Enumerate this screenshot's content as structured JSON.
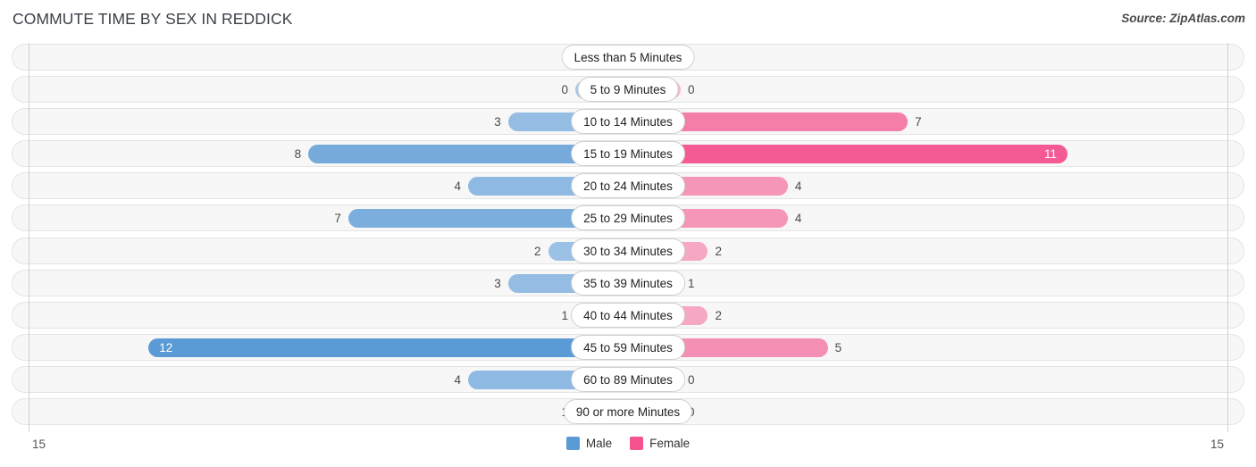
{
  "header": {
    "title": "COMMUTE TIME BY SEX IN REDDICK",
    "source": "Source: ZipAtlas.com"
  },
  "legend": {
    "male_label": "Male",
    "female_label": "Female",
    "male_color": "#5b9bd5",
    "female_color": "#f4538f"
  },
  "axis": {
    "left_end": "15",
    "right_end": "15"
  },
  "chart_data": {
    "type": "bar",
    "subtype": "diverging-bidirectional",
    "title": "COMMUTE TIME BY SEX IN REDDICK",
    "xlabel": "",
    "ylabel": "",
    "xlim": [
      15,
      15
    ],
    "grid": false,
    "legend_position": "bottom-center",
    "categories": [
      "Less than 5 Minutes",
      "5 to 9 Minutes",
      "10 to 14 Minutes",
      "15 to 19 Minutes",
      "20 to 24 Minutes",
      "25 to 29 Minutes",
      "30 to 34 Minutes",
      "35 to 39 Minutes",
      "40 to 44 Minutes",
      "45 to 59 Minutes",
      "60 to 89 Minutes",
      "90 or more Minutes"
    ],
    "series": [
      {
        "name": "Male",
        "direction": "left",
        "color": "#5b9bd5",
        "values": [
          0,
          0,
          3,
          8,
          4,
          7,
          2,
          3,
          1,
          12,
          4,
          1
        ]
      },
      {
        "name": "Female",
        "direction": "right",
        "color": "#f4538f",
        "values": [
          0,
          0,
          7,
          11,
          4,
          4,
          2,
          1,
          2,
          5,
          0,
          0
        ]
      }
    ]
  },
  "rows": [
    {
      "label": "Less than 5 Minutes",
      "male": "0",
      "female": "0",
      "male_v": 0,
      "female_v": 0
    },
    {
      "label": "5 to 9 Minutes",
      "male": "0",
      "female": "0",
      "male_v": 0,
      "female_v": 0
    },
    {
      "label": "10 to 14 Minutes",
      "male": "3",
      "female": "7",
      "male_v": 3,
      "female_v": 7
    },
    {
      "label": "15 to 19 Minutes",
      "male": "8",
      "female": "11",
      "male_v": 8,
      "female_v": 11
    },
    {
      "label": "20 to 24 Minutes",
      "male": "4",
      "female": "4",
      "male_v": 4,
      "female_v": 4
    },
    {
      "label": "25 to 29 Minutes",
      "male": "7",
      "female": "4",
      "male_v": 7,
      "female_v": 4
    },
    {
      "label": "30 to 34 Minutes",
      "male": "2",
      "female": "2",
      "male_v": 2,
      "female_v": 2
    },
    {
      "label": "35 to 39 Minutes",
      "male": "3",
      "female": "1",
      "male_v": 3,
      "female_v": 1
    },
    {
      "label": "40 to 44 Minutes",
      "male": "1",
      "female": "2",
      "male_v": 1,
      "female_v": 2
    },
    {
      "label": "45 to 59 Minutes",
      "male": "12",
      "female": "5",
      "male_v": 12,
      "female_v": 5
    },
    {
      "label": "60 to 89 Minutes",
      "male": "4",
      "female": "0",
      "male_v": 4,
      "female_v": 0
    },
    {
      "label": "90 or more Minutes",
      "male": "1",
      "female": "0",
      "male_v": 1,
      "female_v": 0
    }
  ]
}
